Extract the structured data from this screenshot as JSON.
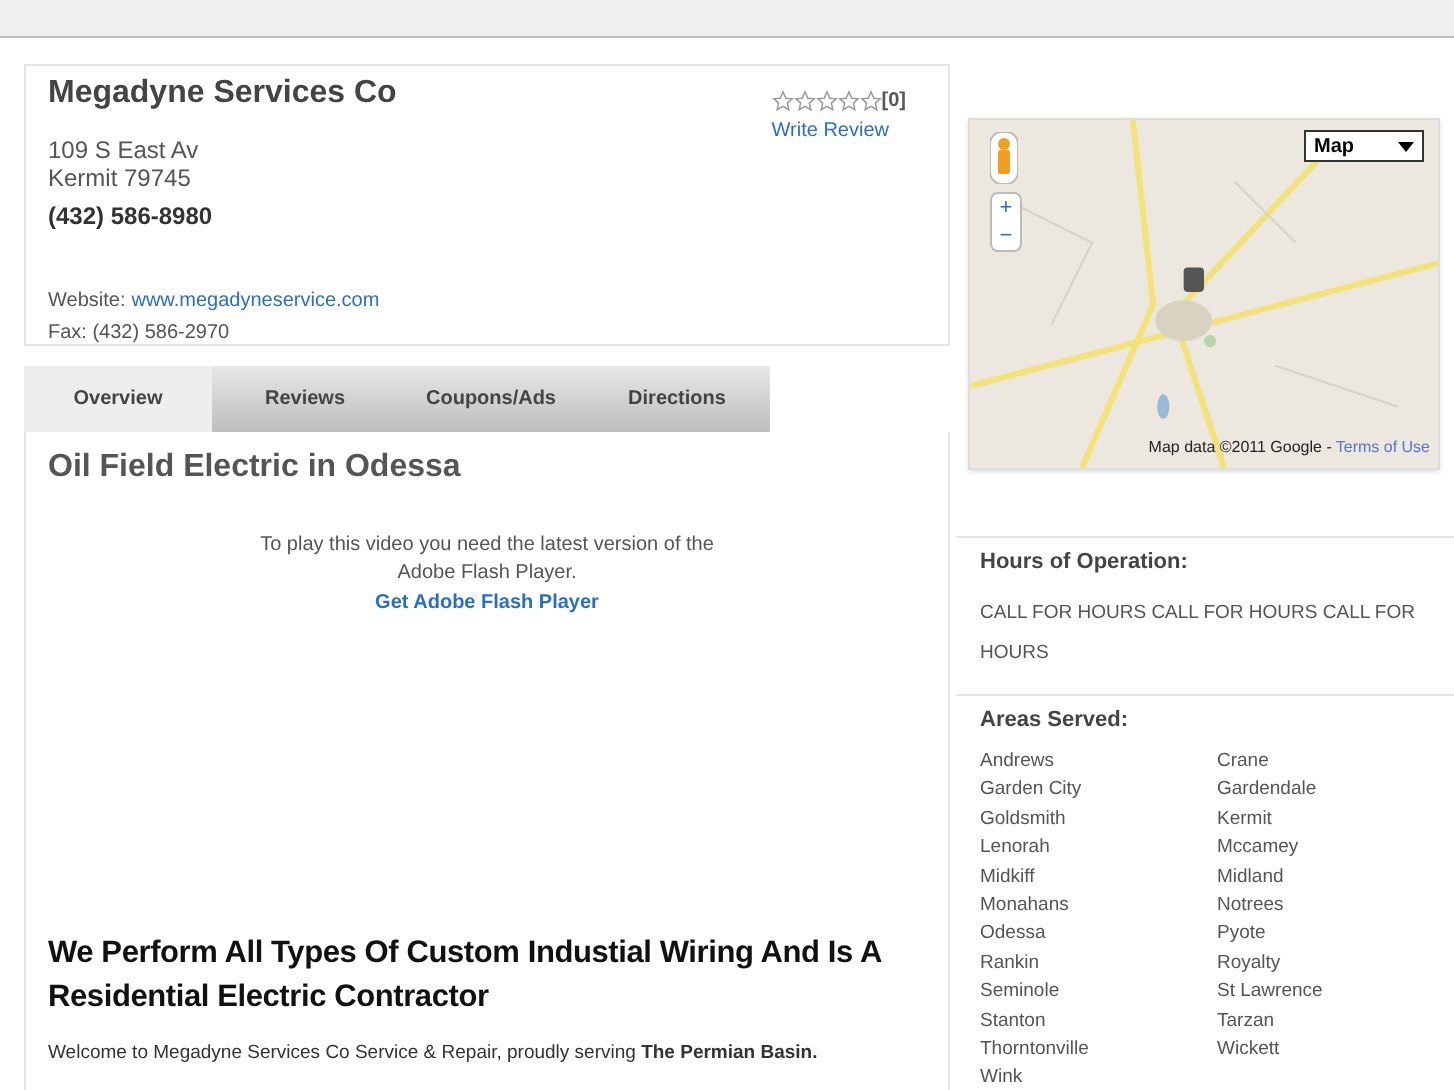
{
  "business": {
    "name": "Megadyne Services Co",
    "street": "109 S East Av",
    "city": "Kermit 79745",
    "phone": "(432) 586-8980",
    "website_label": "Website:",
    "website": "www.megadyneservice.com",
    "fax": "Fax: (432) 586-2970",
    "stars": 0,
    "review_count": "[0]",
    "write_review": "Write Review"
  },
  "tabs": [
    {
      "label": "Overview",
      "selected": true
    },
    {
      "label": "Reviews",
      "selected": false
    },
    {
      "label": "Coupons/Ads",
      "selected": false
    },
    {
      "label": "Directions",
      "selected": false
    }
  ],
  "content": {
    "heading": "Oil Field Electric in Odessa",
    "flash_message": "To play this video you need the latest version of the Adobe Flash Player.",
    "flash_link": "Get Adobe Flash Player",
    "subheading": "We Perform All Types Of Custom Industial Wiring And Is A Residential Electric Contractor",
    "welcome": "Welcome to Megadyne Services Co Service & Repair, proudly serving **The Permian Basin.**"
  },
  "map": {
    "type_select": "Map",
    "zoom_in": "+",
    "zoom_out": "−",
    "attribution": "Map data ©2011 Google -",
    "terms": "Terms of Use"
  },
  "hours": {
    "title": "Hours of Operation:",
    "text": "CALL FOR HOURS CALL FOR HOURS CALL FOR HOURS"
  },
  "areas": {
    "title": "Areas Served:",
    "items": [
      "Andrews",
      "Crane",
      "Garden City",
      "Gardendale",
      "Goldsmith",
      "Kermit",
      "Lenorah",
      "Mccamey",
      "Midkiff",
      "Midland",
      "Monahans",
      "Notrees",
      "Odessa",
      "Pyote",
      "Rankin",
      "Royalty",
      "Seminole",
      "St Lawrence",
      "Stanton",
      "Tarzan",
      "Thorntonville",
      "Wickett",
      "Wink"
    ]
  }
}
